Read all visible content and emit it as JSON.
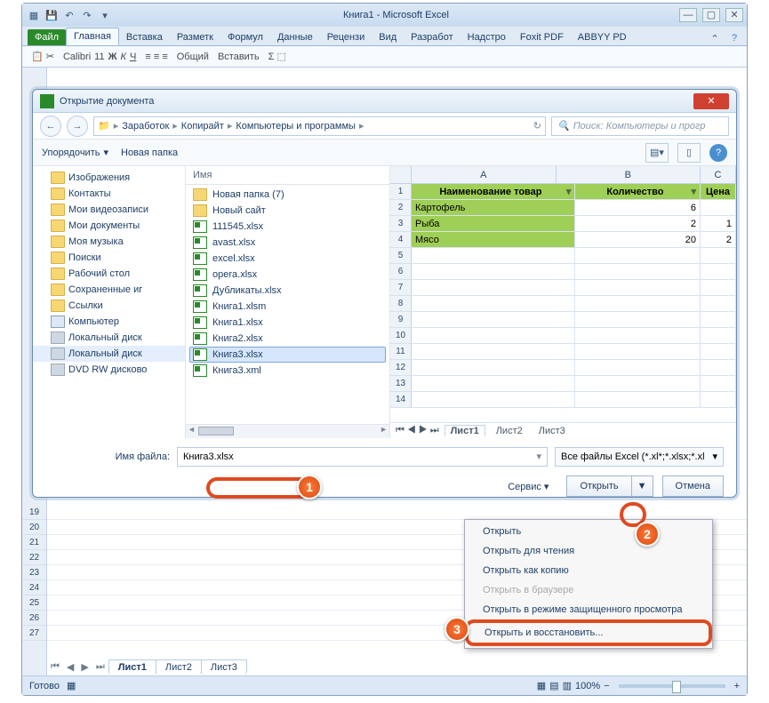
{
  "window": {
    "title": "Книга1 - Microsoft Excel"
  },
  "ribbon": {
    "file": "Файл",
    "tabs": [
      "Главная",
      "Вставка",
      "Разметк",
      "Формул",
      "Данные",
      "Рецензи",
      "Вид",
      "Разработ",
      "Надстро",
      "Foxit PDF",
      "ABBYY PD"
    ],
    "font": "Calibri",
    "size": "11",
    "numfmt": "Общий",
    "insert": "Вставить"
  },
  "dialog": {
    "title": "Открытие документа",
    "breadcrumb": [
      "Заработок",
      "Копирайт",
      "Компьютеры и программы"
    ],
    "search_placeholder": "Поиск: Компьютеры и прогр",
    "organize": "Упорядочить",
    "newfolder": "Новая папка",
    "name_col": "Имя",
    "filename_label": "Имя файла:",
    "filename_value": "Книга3.xlsx",
    "filter": "Все файлы Excel (*.xl*;*.xlsx;*.xl",
    "tools": "Сервис",
    "open": "Открыть",
    "cancel": "Отмена"
  },
  "tree": [
    {
      "label": "Изображения",
      "icon": "folder"
    },
    {
      "label": "Контакты",
      "icon": "folder"
    },
    {
      "label": "Мои видеозаписи",
      "icon": "folder"
    },
    {
      "label": "Мои документы",
      "icon": "folder"
    },
    {
      "label": "Моя музыка",
      "icon": "folder"
    },
    {
      "label": "Поиски",
      "icon": "folder"
    },
    {
      "label": "Рабочий стол",
      "icon": "folder"
    },
    {
      "label": "Сохраненные иг",
      "icon": "folder"
    },
    {
      "label": "Ссылки",
      "icon": "folder"
    },
    {
      "label": "Компьютер",
      "icon": "pc"
    },
    {
      "label": "Локальный диск",
      "icon": "drive"
    },
    {
      "label": "Локальный диск",
      "icon": "drive",
      "sel": true
    },
    {
      "label": "DVD RW дисково",
      "icon": "drive"
    }
  ],
  "files": [
    {
      "label": "Новая папка (7)",
      "icon": "fold"
    },
    {
      "label": "Новый сайт",
      "icon": "fold"
    },
    {
      "label": "111545.xlsx",
      "icon": "xl"
    },
    {
      "label": "avast.xlsx",
      "icon": "xl"
    },
    {
      "label": "excel.xlsx",
      "icon": "xl"
    },
    {
      "label": "opera.xlsx",
      "icon": "xl"
    },
    {
      "label": "Дубликаты.xlsx",
      "icon": "xl"
    },
    {
      "label": "Книга1.xlsm",
      "icon": "xl"
    },
    {
      "label": "Книга1.xlsx",
      "icon": "xl"
    },
    {
      "label": "Книга2.xlsx",
      "icon": "xl"
    },
    {
      "label": "Книга3.xlsx",
      "icon": "xl",
      "sel": true
    },
    {
      "label": "Книга3.xml",
      "icon": "xl"
    }
  ],
  "preview": {
    "cols": [
      "A",
      "B",
      "C"
    ],
    "header": [
      "Наименование товар",
      "Количество",
      "Цена"
    ],
    "rows": [
      {
        "n": 2,
        "a": "Картофель",
        "b": "6",
        "c": ""
      },
      {
        "n": 3,
        "a": "Рыба",
        "b": "2",
        "c": "1"
      },
      {
        "n": 4,
        "a": "Мясо",
        "b": "20",
        "c": "2"
      }
    ],
    "tabs": [
      "Лист1",
      "Лист2",
      "Лист3"
    ]
  },
  "menu": {
    "items": [
      {
        "label": "Открыть"
      },
      {
        "label": "Открыть для чтения"
      },
      {
        "label": "Открыть как копию"
      },
      {
        "label": "Открыть в браузере",
        "disabled": true
      },
      {
        "label": "Открыть в режиме защищенного просмотра"
      },
      {
        "label": "Открыть и восстановить...",
        "boxed": true
      }
    ]
  },
  "sheets": [
    "Лист1",
    "Лист2",
    "Лист3"
  ],
  "status": {
    "ready": "Готово",
    "zoom": "100%"
  },
  "badges": [
    "1",
    "2",
    "3"
  ]
}
